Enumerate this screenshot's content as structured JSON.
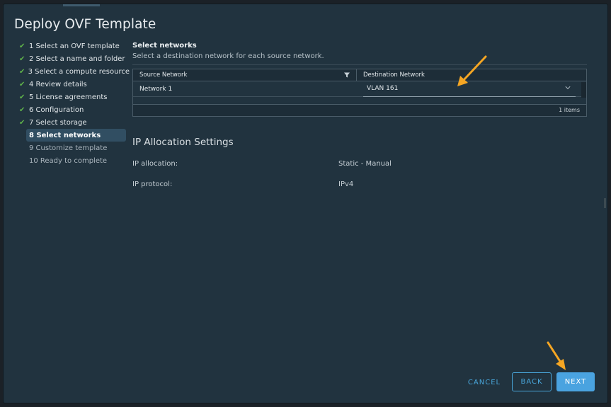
{
  "dialog": {
    "title": "Deploy OVF Template"
  },
  "steps": [
    {
      "label": "1 Select an OVF template",
      "state": "done"
    },
    {
      "label": "2 Select a name and folder",
      "state": "done"
    },
    {
      "label": "3 Select a compute resource",
      "state": "done"
    },
    {
      "label": "4 Review details",
      "state": "done"
    },
    {
      "label": "5 License agreements",
      "state": "done"
    },
    {
      "label": "6 Configuration",
      "state": "done"
    },
    {
      "label": "7 Select storage",
      "state": "done"
    },
    {
      "label": "8 Select networks",
      "state": "active"
    },
    {
      "label": "9 Customize template",
      "state": "future"
    },
    {
      "label": "10 Ready to complete",
      "state": "future"
    }
  ],
  "networks": {
    "title": "Select networks",
    "subtitle": "Select a destination network for each source network.",
    "columns": {
      "source": "Source Network",
      "destination": "Destination Network"
    },
    "rows": [
      {
        "source": "Network 1",
        "destination": "VLAN 161"
      }
    ],
    "items_count": "1 items"
  },
  "ip_settings": {
    "title": "IP Allocation Settings",
    "allocation_label": "IP allocation:",
    "allocation_value": "Static - Manual",
    "protocol_label": "IP protocol:",
    "protocol_value": "IPv4"
  },
  "footer": {
    "cancel": "CANCEL",
    "back": "BACK",
    "next": "NEXT"
  },
  "colors": {
    "accent": "#49a6da",
    "check": "#5fb24a",
    "annotation_arrow": "#f5a623"
  },
  "icons": {
    "step_done": "checkmark-icon",
    "filter": "filter-icon",
    "dropdown": "chevron-down-icon"
  }
}
